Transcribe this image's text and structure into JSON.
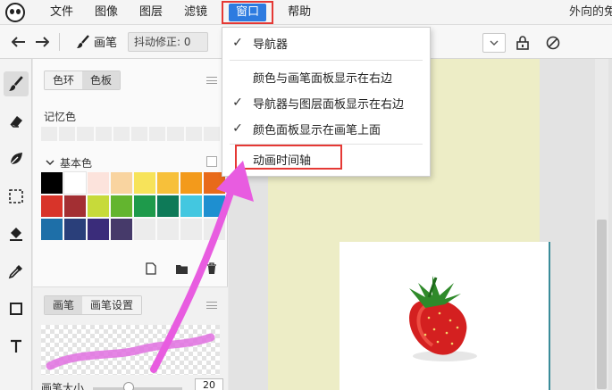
{
  "menubar": {
    "items": [
      "文件",
      "图像",
      "图层",
      "滤镜",
      "窗口",
      "帮助"
    ],
    "active_index": 4,
    "doc_title": "外向的兔"
  },
  "options_bar": {
    "brush_label": "画笔",
    "smoothing_label": "抖动修正: 0"
  },
  "panel": {
    "tabs": [
      "色环",
      "色板"
    ],
    "active_tab": "色板",
    "history_label": "记忆色",
    "basic_colors_label": "基本色",
    "swatch_colors": [
      "#000000",
      "#ffffff",
      "#fce3dc",
      "#f9d4a0",
      "#f7e35a",
      "#f7c03a",
      "#f39a1b",
      "#e86a1a",
      "#d8342a",
      "#a32f33",
      "#c7da3a",
      "#63b52f",
      "#1e9a4b",
      "#0e7a58",
      "#43c7e0",
      "#1e8fd0",
      "#1e6fa8",
      "#2a3f7a",
      "#3a2c7a",
      "#463a6a",
      "",
      "",
      "",
      ""
    ],
    "brush_tabs": [
      "画笔",
      "画笔设置"
    ],
    "active_brush_tab": "画笔",
    "brush_size_label": "画笔大小",
    "brush_size_value": "20"
  },
  "window_menu": {
    "items": [
      {
        "label": "导航器",
        "checked": true
      },
      {
        "label": "颜色与画笔面板显示在右边",
        "checked": false
      },
      {
        "label": "导航器与图层面板显示在右边",
        "checked": true
      },
      {
        "label": "颜色面板显示在画笔上面",
        "checked": true
      },
      {
        "label": "动画时间轴",
        "checked": false
      }
    ]
  },
  "colors": {
    "accent": "#2d7be0",
    "highlight_box": "#e53935",
    "annotation_arrow": "#e85ce0",
    "artboard": "#ededc6"
  }
}
